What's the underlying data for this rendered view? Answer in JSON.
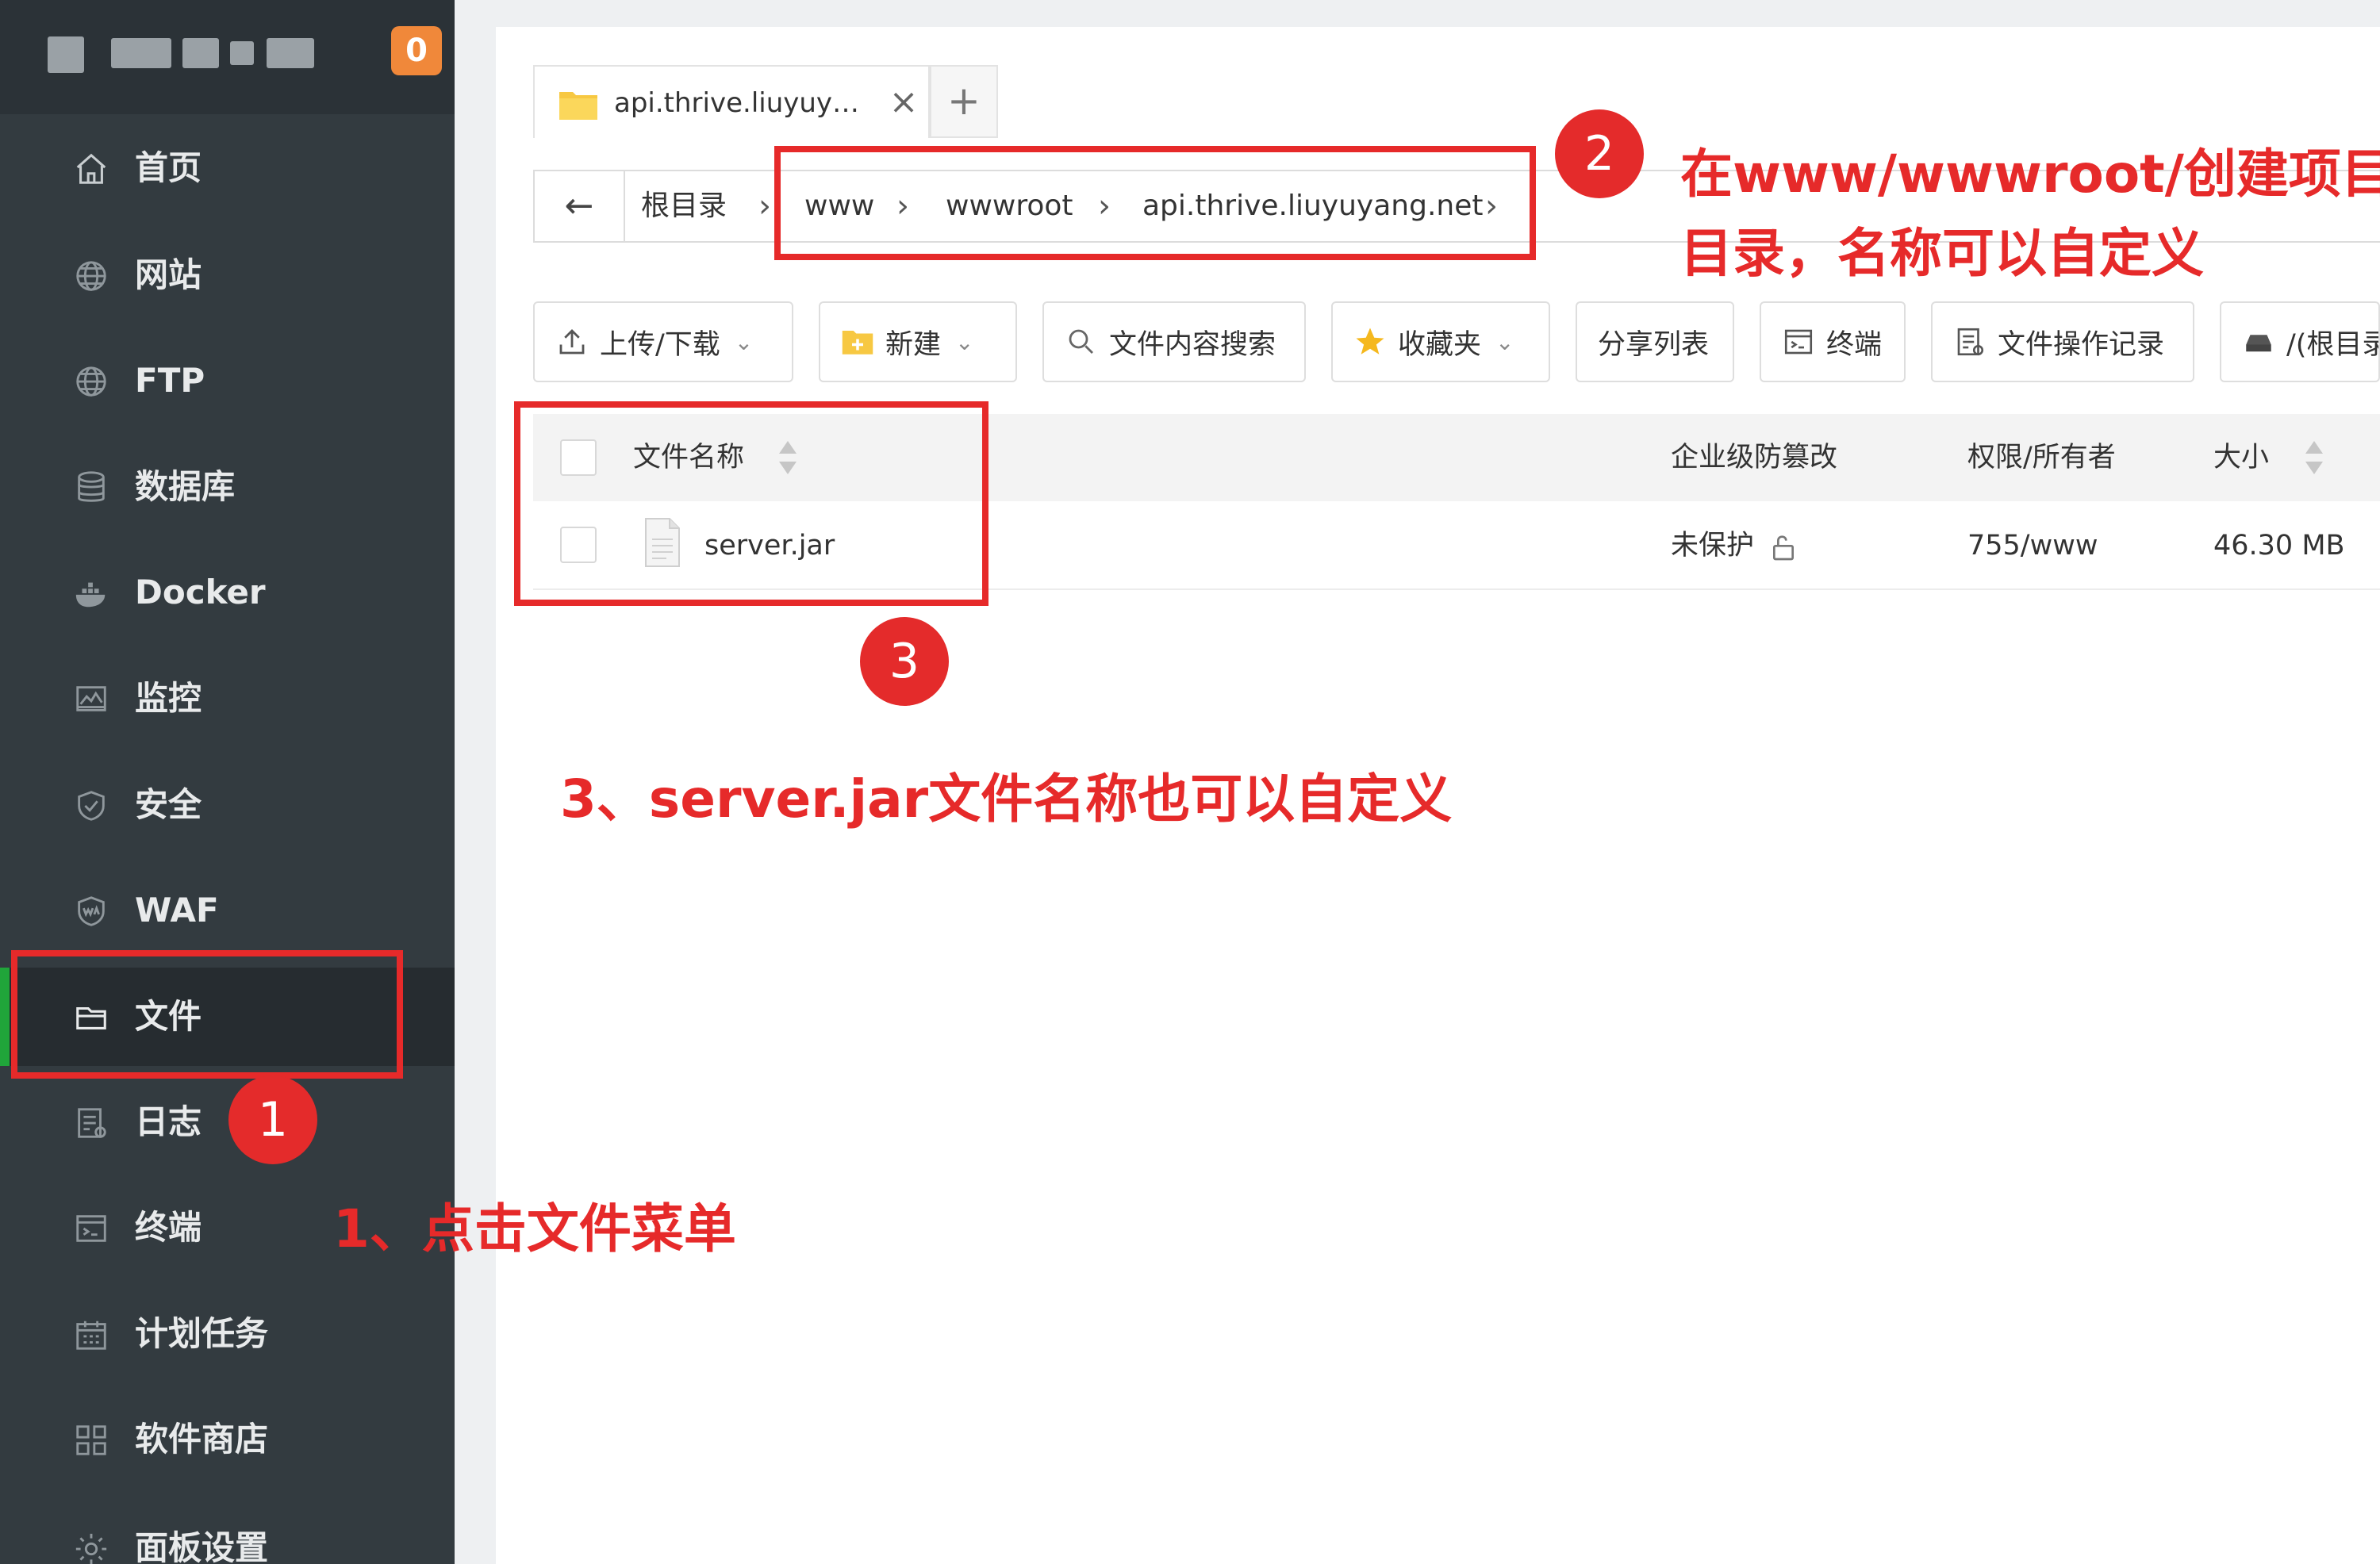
{
  "sidebar": {
    "badge": "0",
    "items": [
      {
        "label": "首页",
        "icon": "home-icon"
      },
      {
        "label": "网站",
        "icon": "globe-icon"
      },
      {
        "label": "FTP",
        "icon": "globe-icon"
      },
      {
        "label": "数据库",
        "icon": "database-icon"
      },
      {
        "label": "Docker",
        "icon": "docker-icon"
      },
      {
        "label": "监控",
        "icon": "monitor-icon"
      },
      {
        "label": "安全",
        "icon": "shield-icon"
      },
      {
        "label": "WAF",
        "icon": "waf-shield-icon"
      },
      {
        "label": "文件",
        "icon": "folder-icon"
      },
      {
        "label": "日志",
        "icon": "log-icon"
      },
      {
        "label": "终端",
        "icon": "terminal-icon"
      },
      {
        "label": "计划任务",
        "icon": "calendar-icon"
      },
      {
        "label": "软件商店",
        "icon": "apps-grid-icon"
      },
      {
        "label": "面板设置",
        "icon": "gear-icon"
      }
    ],
    "active_item": "文件"
  },
  "tabs": [
    {
      "title": "api.thrive.liuyuy…",
      "close": "×"
    }
  ],
  "tab_add": "+",
  "path": {
    "back": "←",
    "crumbs": [
      "根目录",
      "www",
      "wwwroot",
      "api.thrive.liuyuyang.net"
    ],
    "separator": "›"
  },
  "toolbar": {
    "upload": "上传/下载",
    "new": "新建",
    "search": "文件内容搜索",
    "favorites": "收藏夹",
    "share": "分享列表",
    "terminal": "终端",
    "log": "文件操作记录",
    "disk": "/(根目录"
  },
  "table": {
    "headers": {
      "name": "文件名称",
      "protect": "企业级防篡改",
      "perm": "权限/所有者",
      "size": "大小"
    },
    "rows": [
      {
        "name": "server.jar",
        "protect": "未保护",
        "perm": "755/www",
        "size": "46.30 MB"
      }
    ]
  },
  "annotations": {
    "step1_num": "1",
    "step1_text": "1、点击文件菜单",
    "step2_num": "2",
    "step2_text_line1": "在www/wwwroot/创建项目",
    "step2_text_line2": "目录，名称可以自定义",
    "step3_num": "3",
    "step3_text": "3、server.jar文件名称也可以自定义"
  },
  "colors": {
    "sidebar_bg": "#333b40",
    "active_accent": "#20a53a",
    "badge": "#f0883a",
    "annotation_red": "#e62a2a"
  }
}
